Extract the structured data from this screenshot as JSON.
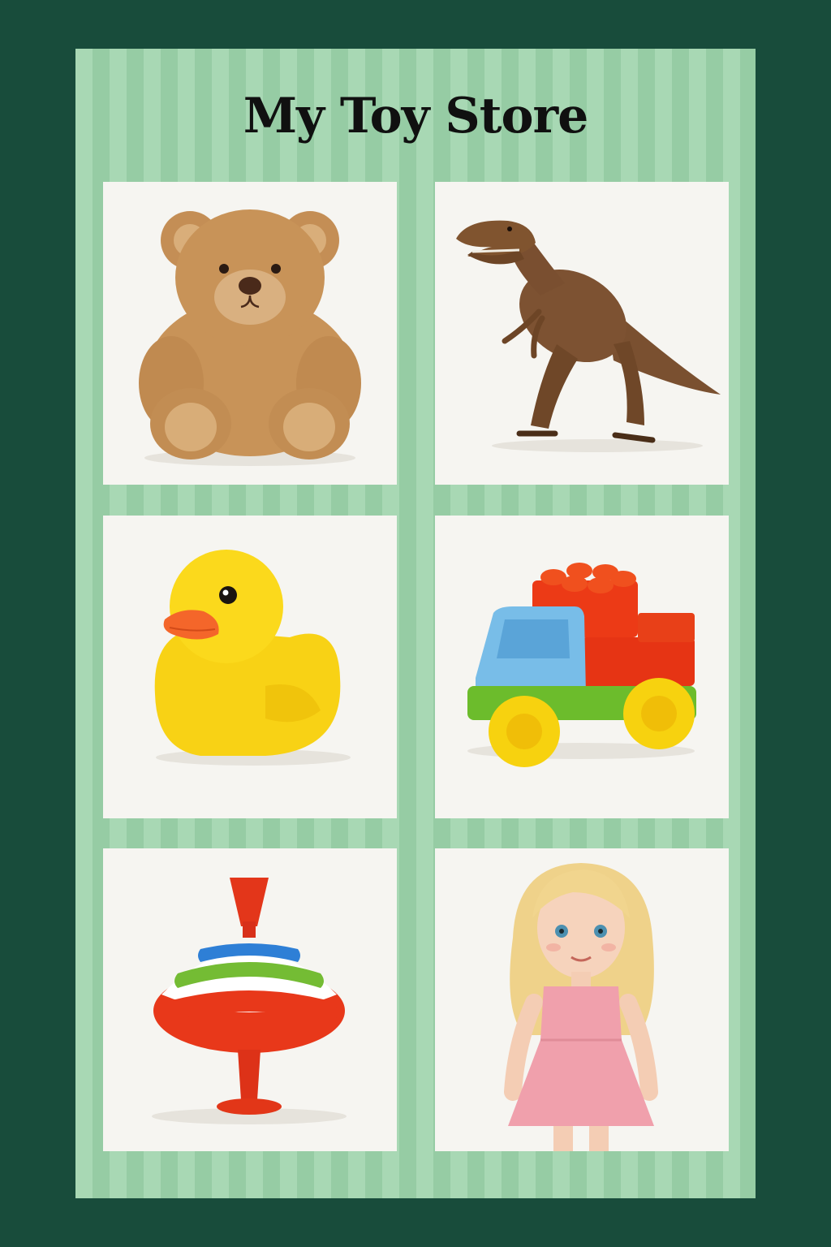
{
  "store": {
    "title": "My Toy Store"
  },
  "products": [
    {
      "icon": "teddy-bear-icon"
    },
    {
      "icon": "tyrannosaurus-icon"
    },
    {
      "icon": "rubber-duck-icon"
    },
    {
      "icon": "block-truck-icon"
    },
    {
      "icon": "spinning-top-icon"
    },
    {
      "icon": "doll-icon"
    }
  ],
  "colors": {
    "page_background": "#184c3b",
    "board_stripe_light": "#a8d8b4",
    "board_stripe_dark": "#96cca4",
    "tile_background": "#f6f5f1"
  }
}
